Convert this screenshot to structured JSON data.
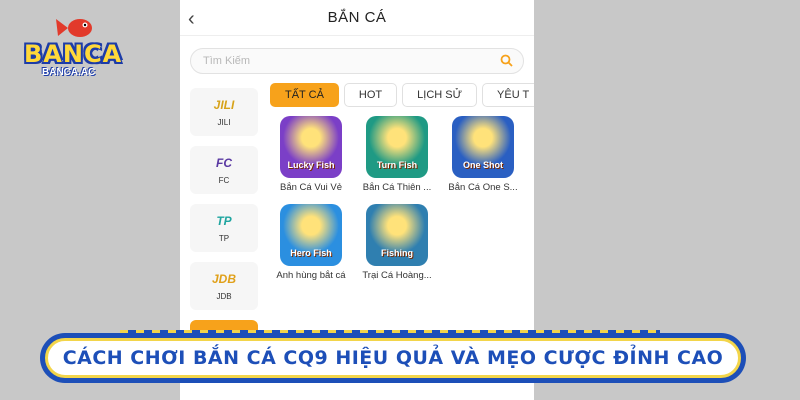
{
  "brand": {
    "logo_text": "BANCA",
    "logo_sub": "BANCA.AC"
  },
  "header": {
    "title": "BẮN CÁ",
    "back_icon": "chevron-left-icon"
  },
  "search": {
    "placeholder": "Tìm Kiếm",
    "icon": "search-icon"
  },
  "providers": [
    {
      "mark": "JILI",
      "label": "JILI",
      "color": "#d7a31a"
    },
    {
      "mark": "FC",
      "label": "FC",
      "color": "#5b3aa3"
    },
    {
      "mark": "TP",
      "label": "TP",
      "color": "#1fa5a0"
    },
    {
      "mark": "JDB",
      "label": "JDB",
      "color": "#e0a019"
    },
    {
      "mark": "",
      "label": "",
      "color": "#f7a21b"
    }
  ],
  "tabs": [
    {
      "label": "TẤT CẢ",
      "active": true
    },
    {
      "label": "HOT",
      "active": false
    },
    {
      "label": "LỊCH SỬ",
      "active": false
    },
    {
      "label": "YÊU T",
      "active": false
    }
  ],
  "games": [
    {
      "name": "Bắn Cá Vui Vẻ",
      "thumb_text": "Lucky Fish",
      "bg": "#7b3fc7"
    },
    {
      "name": "Bắn Cá Thiên ...",
      "thumb_text": "Turn Fish",
      "bg": "#1f9a84"
    },
    {
      "name": "Bắn Cá One S...",
      "thumb_text": "One Shot",
      "bg": "#2a5fc2"
    },
    {
      "name": "Anh hùng bắt cá",
      "thumb_text": "Hero Fish",
      "bg": "#2b8fe0"
    },
    {
      "name": "Trại Cá Hoàng...",
      "thumb_text": "Fishing",
      "bg": "#2f7fb0"
    }
  ],
  "banner": {
    "text": "CÁCH CHƠI BẮN CÁ CQ9 HIỆU QUẢ VÀ MẸO CƯỢC ĐỈNH CAO"
  },
  "colors": {
    "accent": "#f7a21b",
    "banner_blue": "#1d4fb8",
    "banner_gold": "#f3d54a"
  }
}
